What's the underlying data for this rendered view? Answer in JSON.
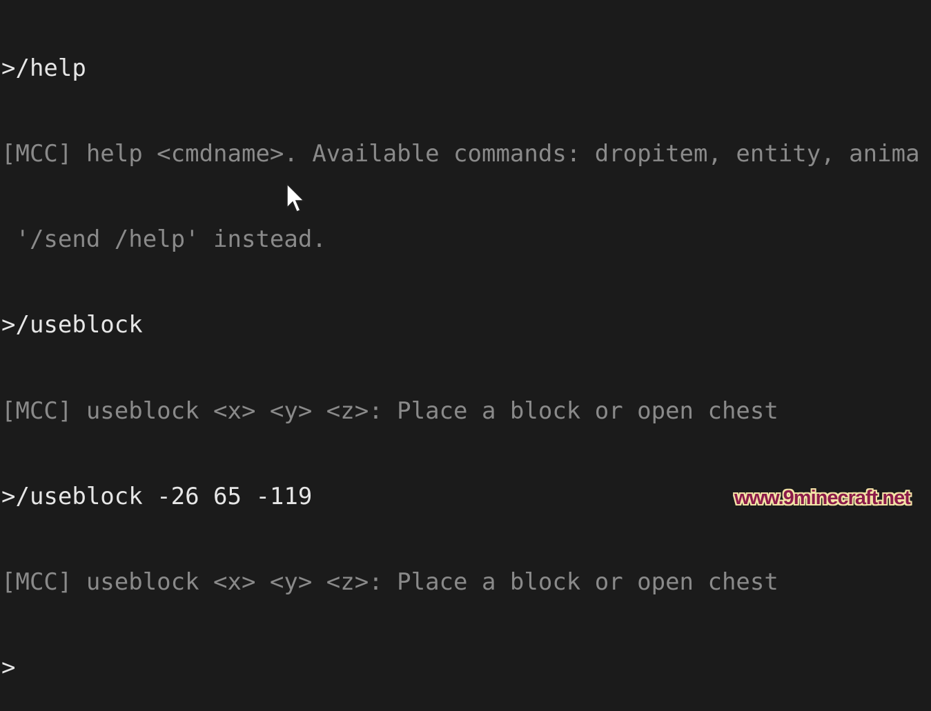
{
  "console": {
    "lines": [
      {
        "type": "input",
        "text": ">/help"
      },
      {
        "type": "output",
        "text": "[MCC] help <cmdname>. Available commands: dropitem, entity, anima"
      },
      {
        "type": "output",
        "text": " '/send /help' instead."
      },
      {
        "type": "input",
        "text": ">/useblock"
      },
      {
        "type": "output",
        "text": "[MCC] useblock <x> <y> <z>: Place a block or open chest"
      },
      {
        "type": "input",
        "text": ">/useblock -26 65 -119"
      },
      {
        "type": "output",
        "text": "[MCC] useblock <x> <y> <z>: Place a block or open chest"
      },
      {
        "type": "input",
        "text": ">"
      }
    ]
  },
  "colors": {
    "background": "#1b1b1b",
    "input_text": "#e6e6e6",
    "output_text": "#8a8a8a"
  },
  "cursor_icon": "mouse-pointer-icon",
  "watermark": "www.9minecraft.net"
}
